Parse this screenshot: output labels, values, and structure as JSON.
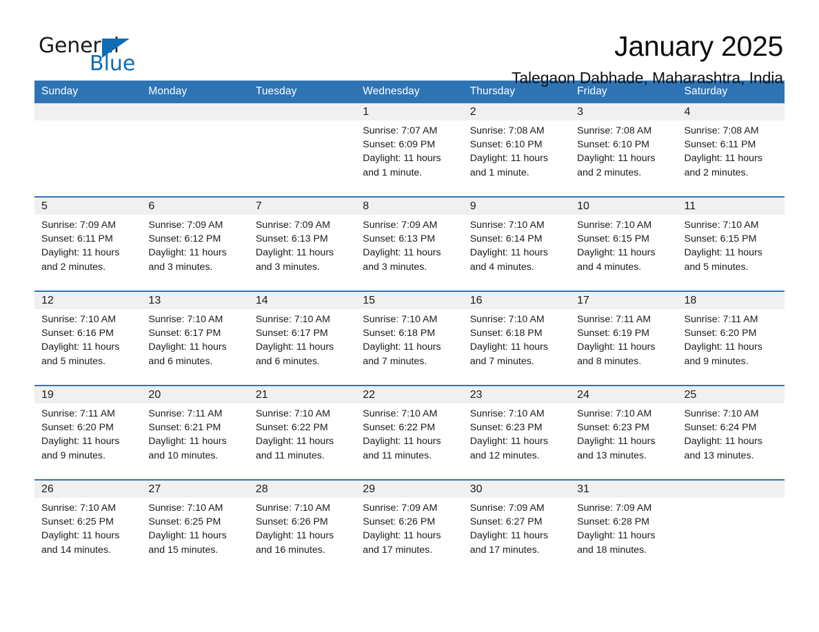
{
  "brand": {
    "name_part1": "General",
    "name_part2": "Blue",
    "triangle_color": "#0f6cb5"
  },
  "header": {
    "title": "January 2025",
    "subtitle": "Talegaon Dabhade, Maharashtra, India",
    "accent_color": "#2e74b5"
  },
  "calendar": {
    "weekday_headers": [
      "Sunday",
      "Monday",
      "Tuesday",
      "Wednesday",
      "Thursday",
      "Friday",
      "Saturday"
    ],
    "labels": {
      "sunrise": "Sunrise:",
      "sunset": "Sunset:",
      "daylight": "Daylight:"
    },
    "weeks": [
      [
        {
          "day": "",
          "empty": true
        },
        {
          "day": "",
          "empty": true
        },
        {
          "day": "",
          "empty": true
        },
        {
          "day": "1",
          "sunrise": "Sunrise: 7:07 AM",
          "sunset": "Sunset: 6:09 PM",
          "daylight": "Daylight: 11 hours and 1 minute."
        },
        {
          "day": "2",
          "sunrise": "Sunrise: 7:08 AM",
          "sunset": "Sunset: 6:10 PM",
          "daylight": "Daylight: 11 hours and 1 minute."
        },
        {
          "day": "3",
          "sunrise": "Sunrise: 7:08 AM",
          "sunset": "Sunset: 6:10 PM",
          "daylight": "Daylight: 11 hours and 2 minutes."
        },
        {
          "day": "4",
          "sunrise": "Sunrise: 7:08 AM",
          "sunset": "Sunset: 6:11 PM",
          "daylight": "Daylight: 11 hours and 2 minutes."
        }
      ],
      [
        {
          "day": "5",
          "sunrise": "Sunrise: 7:09 AM",
          "sunset": "Sunset: 6:11 PM",
          "daylight": "Daylight: 11 hours and 2 minutes."
        },
        {
          "day": "6",
          "sunrise": "Sunrise: 7:09 AM",
          "sunset": "Sunset: 6:12 PM",
          "daylight": "Daylight: 11 hours and 3 minutes."
        },
        {
          "day": "7",
          "sunrise": "Sunrise: 7:09 AM",
          "sunset": "Sunset: 6:13 PM",
          "daylight": "Daylight: 11 hours and 3 minutes."
        },
        {
          "day": "8",
          "sunrise": "Sunrise: 7:09 AM",
          "sunset": "Sunset: 6:13 PM",
          "daylight": "Daylight: 11 hours and 3 minutes."
        },
        {
          "day": "9",
          "sunrise": "Sunrise: 7:10 AM",
          "sunset": "Sunset: 6:14 PM",
          "daylight": "Daylight: 11 hours and 4 minutes."
        },
        {
          "day": "10",
          "sunrise": "Sunrise: 7:10 AM",
          "sunset": "Sunset: 6:15 PM",
          "daylight": "Daylight: 11 hours and 4 minutes."
        },
        {
          "day": "11",
          "sunrise": "Sunrise: 7:10 AM",
          "sunset": "Sunset: 6:15 PM",
          "daylight": "Daylight: 11 hours and 5 minutes."
        }
      ],
      [
        {
          "day": "12",
          "sunrise": "Sunrise: 7:10 AM",
          "sunset": "Sunset: 6:16 PM",
          "daylight": "Daylight: 11 hours and 5 minutes."
        },
        {
          "day": "13",
          "sunrise": "Sunrise: 7:10 AM",
          "sunset": "Sunset: 6:17 PM",
          "daylight": "Daylight: 11 hours and 6 minutes."
        },
        {
          "day": "14",
          "sunrise": "Sunrise: 7:10 AM",
          "sunset": "Sunset: 6:17 PM",
          "daylight": "Daylight: 11 hours and 6 minutes."
        },
        {
          "day": "15",
          "sunrise": "Sunrise: 7:10 AM",
          "sunset": "Sunset: 6:18 PM",
          "daylight": "Daylight: 11 hours and 7 minutes."
        },
        {
          "day": "16",
          "sunrise": "Sunrise: 7:10 AM",
          "sunset": "Sunset: 6:18 PM",
          "daylight": "Daylight: 11 hours and 7 minutes."
        },
        {
          "day": "17",
          "sunrise": "Sunrise: 7:11 AM",
          "sunset": "Sunset: 6:19 PM",
          "daylight": "Daylight: 11 hours and 8 minutes."
        },
        {
          "day": "18",
          "sunrise": "Sunrise: 7:11 AM",
          "sunset": "Sunset: 6:20 PM",
          "daylight": "Daylight: 11 hours and 9 minutes."
        }
      ],
      [
        {
          "day": "19",
          "sunrise": "Sunrise: 7:11 AM",
          "sunset": "Sunset: 6:20 PM",
          "daylight": "Daylight: 11 hours and 9 minutes."
        },
        {
          "day": "20",
          "sunrise": "Sunrise: 7:11 AM",
          "sunset": "Sunset: 6:21 PM",
          "daylight": "Daylight: 11 hours and 10 minutes."
        },
        {
          "day": "21",
          "sunrise": "Sunrise: 7:10 AM",
          "sunset": "Sunset: 6:22 PM",
          "daylight": "Daylight: 11 hours and 11 minutes."
        },
        {
          "day": "22",
          "sunrise": "Sunrise: 7:10 AM",
          "sunset": "Sunset: 6:22 PM",
          "daylight": "Daylight: 11 hours and 11 minutes."
        },
        {
          "day": "23",
          "sunrise": "Sunrise: 7:10 AM",
          "sunset": "Sunset: 6:23 PM",
          "daylight": "Daylight: 11 hours and 12 minutes."
        },
        {
          "day": "24",
          "sunrise": "Sunrise: 7:10 AM",
          "sunset": "Sunset: 6:23 PM",
          "daylight": "Daylight: 11 hours and 13 minutes."
        },
        {
          "day": "25",
          "sunrise": "Sunrise: 7:10 AM",
          "sunset": "Sunset: 6:24 PM",
          "daylight": "Daylight: 11 hours and 13 minutes."
        }
      ],
      [
        {
          "day": "26",
          "sunrise": "Sunrise: 7:10 AM",
          "sunset": "Sunset: 6:25 PM",
          "daylight": "Daylight: 11 hours and 14 minutes."
        },
        {
          "day": "27",
          "sunrise": "Sunrise: 7:10 AM",
          "sunset": "Sunset: 6:25 PM",
          "daylight": "Daylight: 11 hours and 15 minutes."
        },
        {
          "day": "28",
          "sunrise": "Sunrise: 7:10 AM",
          "sunset": "Sunset: 6:26 PM",
          "daylight": "Daylight: 11 hours and 16 minutes."
        },
        {
          "day": "29",
          "sunrise": "Sunrise: 7:09 AM",
          "sunset": "Sunset: 6:26 PM",
          "daylight": "Daylight: 11 hours and 17 minutes."
        },
        {
          "day": "30",
          "sunrise": "Sunrise: 7:09 AM",
          "sunset": "Sunset: 6:27 PM",
          "daylight": "Daylight: 11 hours and 17 minutes."
        },
        {
          "day": "31",
          "sunrise": "Sunrise: 7:09 AM",
          "sunset": "Sunset: 6:28 PM",
          "daylight": "Daylight: 11 hours and 18 minutes."
        },
        {
          "day": "",
          "empty": true
        }
      ]
    ]
  }
}
